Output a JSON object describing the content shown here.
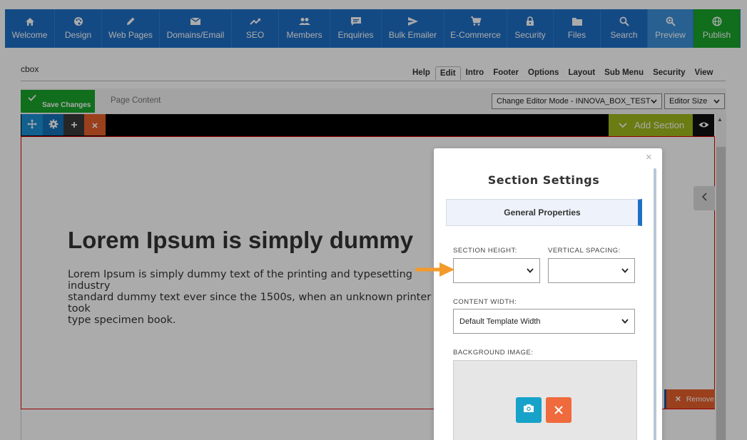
{
  "nav": {
    "items": [
      {
        "label": "Welcome",
        "icon": "home-icon"
      },
      {
        "label": "Design",
        "icon": "palette-icon"
      },
      {
        "label": "Web Pages",
        "icon": "pencil-icon"
      },
      {
        "label": "Domains/Email",
        "icon": "envelope-icon"
      },
      {
        "label": "SEO",
        "icon": "trending-icon"
      },
      {
        "label": "Members",
        "icon": "users-icon"
      },
      {
        "label": "Enquiries",
        "icon": "chat-icon"
      },
      {
        "label": "Bulk Emailer",
        "icon": "send-icon"
      },
      {
        "label": "E-Commerce",
        "icon": "cart-icon"
      },
      {
        "label": "Security",
        "icon": "lock-icon"
      },
      {
        "label": "Files",
        "icon": "folder-icon"
      },
      {
        "label": "Search",
        "icon": "search-icon"
      },
      {
        "label": "Preview",
        "icon": "zoom-icon"
      },
      {
        "label": "Publish",
        "icon": "globe-icon"
      }
    ]
  },
  "page": {
    "name": "cbox"
  },
  "tabs": [
    "Help",
    "Edit",
    "Intro",
    "Footer",
    "Options",
    "Layout",
    "Sub Menu",
    "Security",
    "View"
  ],
  "toolbar": {
    "save_label": "Save Changes",
    "page_content_label": "Page Content",
    "editor_mode": "Change Editor Mode - INNOVA_BOX_TEST",
    "editor_size": "Editor Size"
  },
  "editor": {
    "add_section_label": "Add Section",
    "remove_label": "Remove",
    "hero_title": "Lorem Ipsum is simply dummy",
    "hero_line1": "Lorem Ipsum is simply dummy text of the printing and typesetting industry",
    "hero_line2": "standard dummy text ever since the 1500s, when an unknown printer took",
    "hero_line3": "type specimen book."
  },
  "modal": {
    "title": "Section Settings",
    "section_tab": "General Properties",
    "section_height_label": "SECTION HEIGHT:",
    "section_height_value": "",
    "vertical_spacing_label": "VERTICAL SPACING:",
    "vertical_spacing_value": "",
    "content_width_label": "CONTENT WIDTH:",
    "content_width_value": "Default Template Width",
    "background_image_label": "BACKGROUND IMAGE:",
    "close_symbol": "×"
  },
  "colors": {
    "nav_blue": "#1f6fc5",
    "publish_green": "#18a52a",
    "add_section_green": "#9fb91c",
    "remove_orange": "#e8602c",
    "camera_blue": "#17a2c9",
    "arrow_orange": "#f39a2b"
  }
}
